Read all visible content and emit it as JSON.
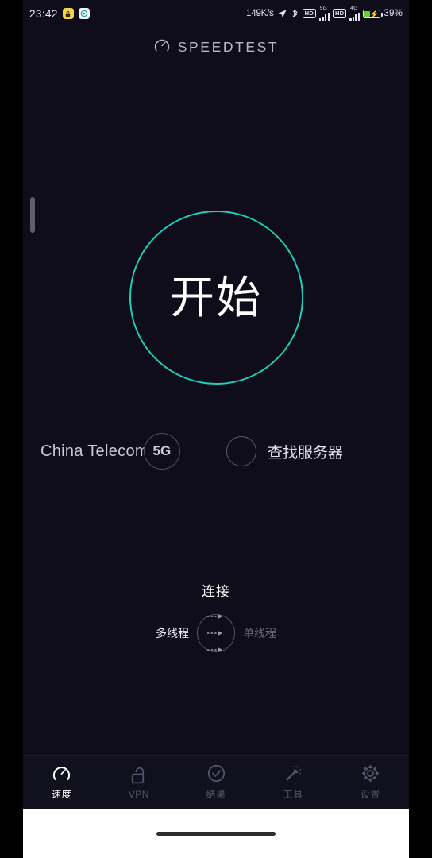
{
  "statusbar": {
    "time": "23:42",
    "app_icon_1": "lock-app-icon",
    "app_icon_2": "camera-app-icon",
    "network_speed": "149K/s",
    "location_icon": "location-arrow-icon",
    "bluetooth_icon": "bluetooth-icon",
    "hd_badge_1": "HD",
    "sim1_tag": "5G",
    "hd_badge_2": "HD",
    "sim2_tag": "4G",
    "battery_percent": "39%",
    "battery_level": 39,
    "charging": true
  },
  "header": {
    "icon": "speedometer-icon",
    "title": "SPEEDTEST"
  },
  "go_button": {
    "label": "开始",
    "accent_color": "#1ecfbb"
  },
  "isp_row": {
    "isp_name": "China Telecom",
    "network_badge": "5G",
    "server_icon": "empty-circle-icon",
    "server_label": "查找服务器"
  },
  "connection": {
    "title": "连接",
    "multi_thread_label": "多线程",
    "single_thread_label": "单线程",
    "toggle_icon": "multi-arrow-icon",
    "selected": "多线程"
  },
  "bottom_nav": {
    "items": [
      {
        "label": "速度",
        "icon": "speedometer-icon",
        "active": true
      },
      {
        "label": "VPN",
        "icon": "unlock-icon",
        "active": false
      },
      {
        "label": "结果",
        "icon": "check-circle-icon",
        "active": false
      },
      {
        "label": "工具",
        "icon": "magic-wand-icon",
        "active": false
      },
      {
        "label": "设置",
        "icon": "gear-icon",
        "active": false
      }
    ]
  },
  "gesture_bar": {
    "handle": "home-gesture-pill"
  },
  "colors": {
    "background": "#0e0d19",
    "nav_background": "#11101d",
    "accent": "#1ecfbb",
    "text_primary": "#ffffff",
    "text_muted": "#55546b"
  }
}
